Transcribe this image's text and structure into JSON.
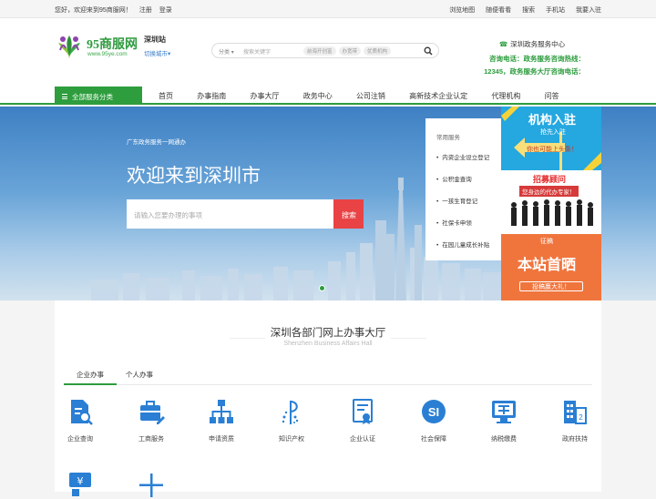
{
  "topbar": {
    "greeting": "您好，欢迎来到95商服网！",
    "register": "注册",
    "login": "登录",
    "links": [
      "浏览地图",
      "随便看看",
      "搜索",
      "手机站",
      "我要入驻"
    ]
  },
  "header": {
    "logo_text": "95商服网",
    "logo_url": "www.95ye.com",
    "site_name": "深圳站",
    "switch_city": "切换城市",
    "search": {
      "category": "分类",
      "placeholder": "搜索关键字",
      "tags": [
        "前海开创富",
        "办宽带",
        "优质机构"
      ]
    },
    "hotline_title": "深圳政务服务中心",
    "hotline_line1": "咨询电话：政务服务咨询热线：",
    "hotline_line2": "12345，政务服务大厅咨询电话："
  },
  "nav": {
    "all_label": "全部服务分类",
    "items": [
      "首页",
      "办事指南",
      "办事大厅",
      "政务中心",
      "公司注销",
      "高新技术企业认定",
      "代理机构",
      "问答"
    ]
  },
  "banner": {
    "subtitle": "广东政务服务一网通办",
    "heading": "欢迎来到深圳市",
    "input_placeholder": "请输入您要办理的事项",
    "search_button": "搜索"
  },
  "services_panel": {
    "title": "常用服务",
    "items": [
      "内资企业设立登记",
      "公积金查询",
      "一孩生育登记",
      "社保卡申领",
      "在园儿童成长补贴"
    ]
  },
  "ads": {
    "ad1_title": "机构入驻",
    "ad1_sub1": "抢先入驻",
    "ad1_sub2": "你也可能上头条！",
    "ad2_title": "招募顾问",
    "ad2_sub": "您身边的代办专家！",
    "ad3_small": "征稿",
    "ad3_title": "本站首晒",
    "ad3_sub": "投稿赢大礼！"
  },
  "hall": {
    "title": "深圳各部门网上办事大厅",
    "subtitle": "Shenzhen Business Affairs Hall",
    "tabs": [
      "企业办事",
      "个人办事"
    ],
    "items": [
      "企业查询",
      "工商服务",
      "申请资质",
      "知识产权",
      "企业认证",
      "社会保障",
      "纳税缴费",
      "政府扶持"
    ]
  },
  "colors": {
    "brand_green": "#2e9d3d",
    "icon_blue": "#2a7fd4",
    "search_red": "#e94345"
  }
}
